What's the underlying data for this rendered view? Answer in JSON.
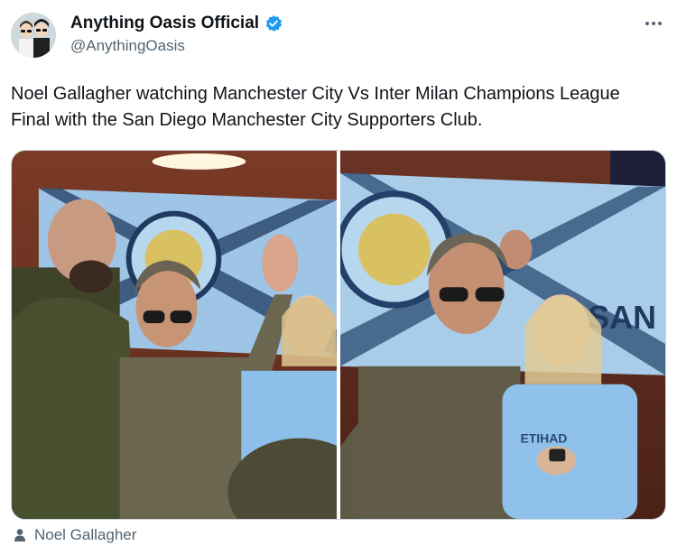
{
  "tweet": {
    "display_name": "Anything Oasis Official",
    "handle": "@AnythingOasis",
    "text": "Noel Gallagher watching Manchester City Vs Inter Milan Champions League Final with the San Diego Manchester City Supporters Club.",
    "verified_color": "#1d9bf0",
    "avatar_icon": "cartoon-avatar",
    "more_icon": "ellipsis-icon"
  },
  "media": {
    "photos": [
      {
        "description_icon": "photo-1"
      },
      {
        "description_icon": "photo-2"
      }
    ],
    "banner_text": "SAN",
    "shirt_text": "ETIHAD"
  },
  "tags": {
    "person_icon": "person-icon",
    "tagged_name": "Noel Gallagher"
  }
}
